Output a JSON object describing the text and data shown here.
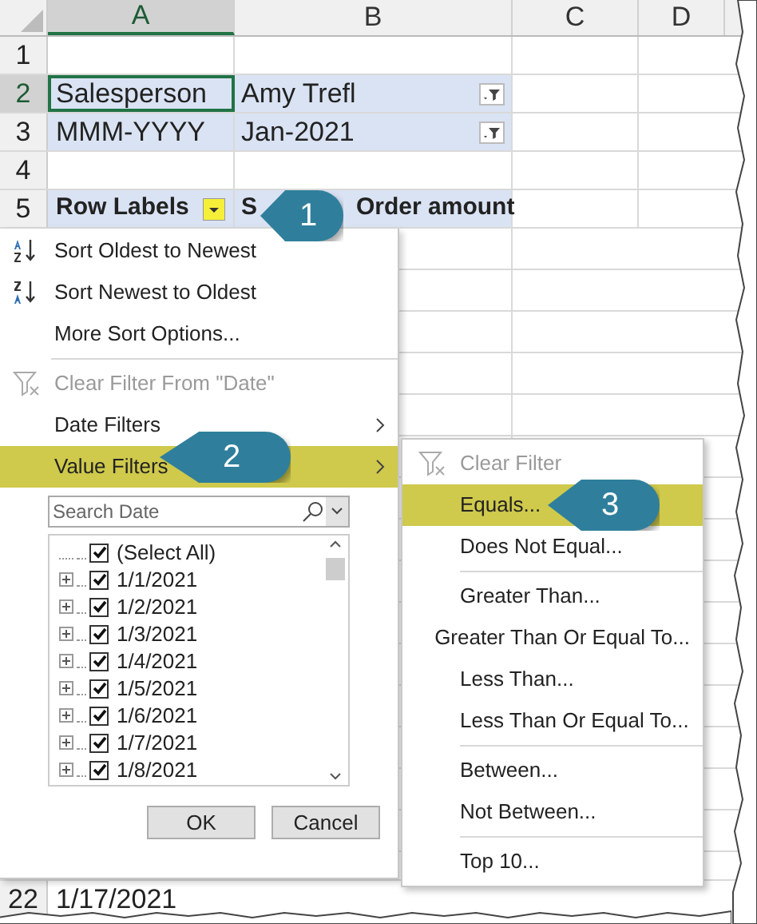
{
  "sheet": {
    "columns": [
      {
        "label": "A",
        "selected": true
      },
      {
        "label": "B",
        "selected": false
      },
      {
        "label": "C",
        "selected": false
      },
      {
        "label": "D",
        "selected": false
      }
    ],
    "rows": [
      {
        "label": "1",
        "selected": false,
        "cells": []
      },
      {
        "label": "2",
        "selected": true,
        "cells": [
          "Salesperson",
          "Amy Trefl"
        ],
        "filter": true
      },
      {
        "label": "3",
        "selected": false,
        "cells": [
          "MMM-YYYY",
          "Jan-2021"
        ],
        "filter": true
      },
      {
        "label": "4",
        "selected": false,
        "cells": []
      },
      {
        "label": "5",
        "selected": false,
        "header": true,
        "cells": [
          "Row Labels"
        ],
        "b_parts": [
          "S",
          "Order amount"
        ]
      }
    ],
    "bottom_row": {
      "label": "22",
      "cells": [
        "1/17/2021"
      ]
    }
  },
  "menu": {
    "items": [
      {
        "kind": "ascending",
        "label": "Sort Oldest to Newest",
        "selected": false,
        "disabled": false
      },
      {
        "kind": "descending",
        "label": "Sort Newest to Oldest",
        "selected": false,
        "disabled": false
      },
      {
        "kind": "plain",
        "label": "More Sort Options...",
        "selected": false,
        "disabled": false
      },
      {
        "kind": "separator"
      },
      {
        "kind": "clear",
        "label": "Clear Filter From \"Date\"",
        "selected": false,
        "disabled": true
      },
      {
        "kind": "submenu",
        "label": "Date Filters",
        "selected": false,
        "disabled": false
      },
      {
        "kind": "submenu",
        "label": "Value Filters",
        "selected": true,
        "disabled": false
      }
    ],
    "search": {
      "placeholder": "Search Date"
    },
    "list": [
      {
        "label": "(Select All)",
        "checked": true,
        "expandable": false
      },
      {
        "label": "1/1/2021",
        "checked": true,
        "expandable": true
      },
      {
        "label": "1/2/2021",
        "checked": true,
        "expandable": true
      },
      {
        "label": "1/3/2021",
        "checked": true,
        "expandable": true
      },
      {
        "label": "1/4/2021",
        "checked": true,
        "expandable": true
      },
      {
        "label": "1/5/2021",
        "checked": true,
        "expandable": true
      },
      {
        "label": "1/6/2021",
        "checked": true,
        "expandable": true
      },
      {
        "label": "1/7/2021",
        "checked": true,
        "expandable": true
      },
      {
        "label": "1/8/2021",
        "checked": true,
        "expandable": true
      }
    ],
    "buttons": [
      "OK",
      "Cancel"
    ]
  },
  "submenu": {
    "items": [
      {
        "kind": "clear",
        "label": "Clear Filter",
        "selected": false,
        "disabled": true
      },
      {
        "kind": "plain",
        "label": "Equals...",
        "selected": true,
        "disabled": false
      },
      {
        "kind": "plain",
        "label": "Does Not Equal...",
        "selected": false,
        "disabled": false
      },
      {
        "kind": "separator"
      },
      {
        "kind": "plain",
        "label": "Greater Than...",
        "selected": false,
        "disabled": false
      },
      {
        "kind": "plain",
        "label": "Greater Than Or Equal To...",
        "selected": false,
        "disabled": false
      },
      {
        "kind": "plain",
        "label": "Less Than...",
        "selected": false,
        "disabled": false
      },
      {
        "kind": "plain",
        "label": "Less Than Or Equal To...",
        "selected": false,
        "disabled": false
      },
      {
        "kind": "separator"
      },
      {
        "kind": "plain",
        "label": "Between...",
        "selected": false,
        "disabled": false
      },
      {
        "kind": "plain",
        "label": "Not Between...",
        "selected": false,
        "disabled": false
      },
      {
        "kind": "separator"
      },
      {
        "kind": "plain",
        "label": "Top 10...",
        "selected": false,
        "disabled": false
      }
    ]
  },
  "callouts": [
    "1",
    "2",
    "3"
  ]
}
